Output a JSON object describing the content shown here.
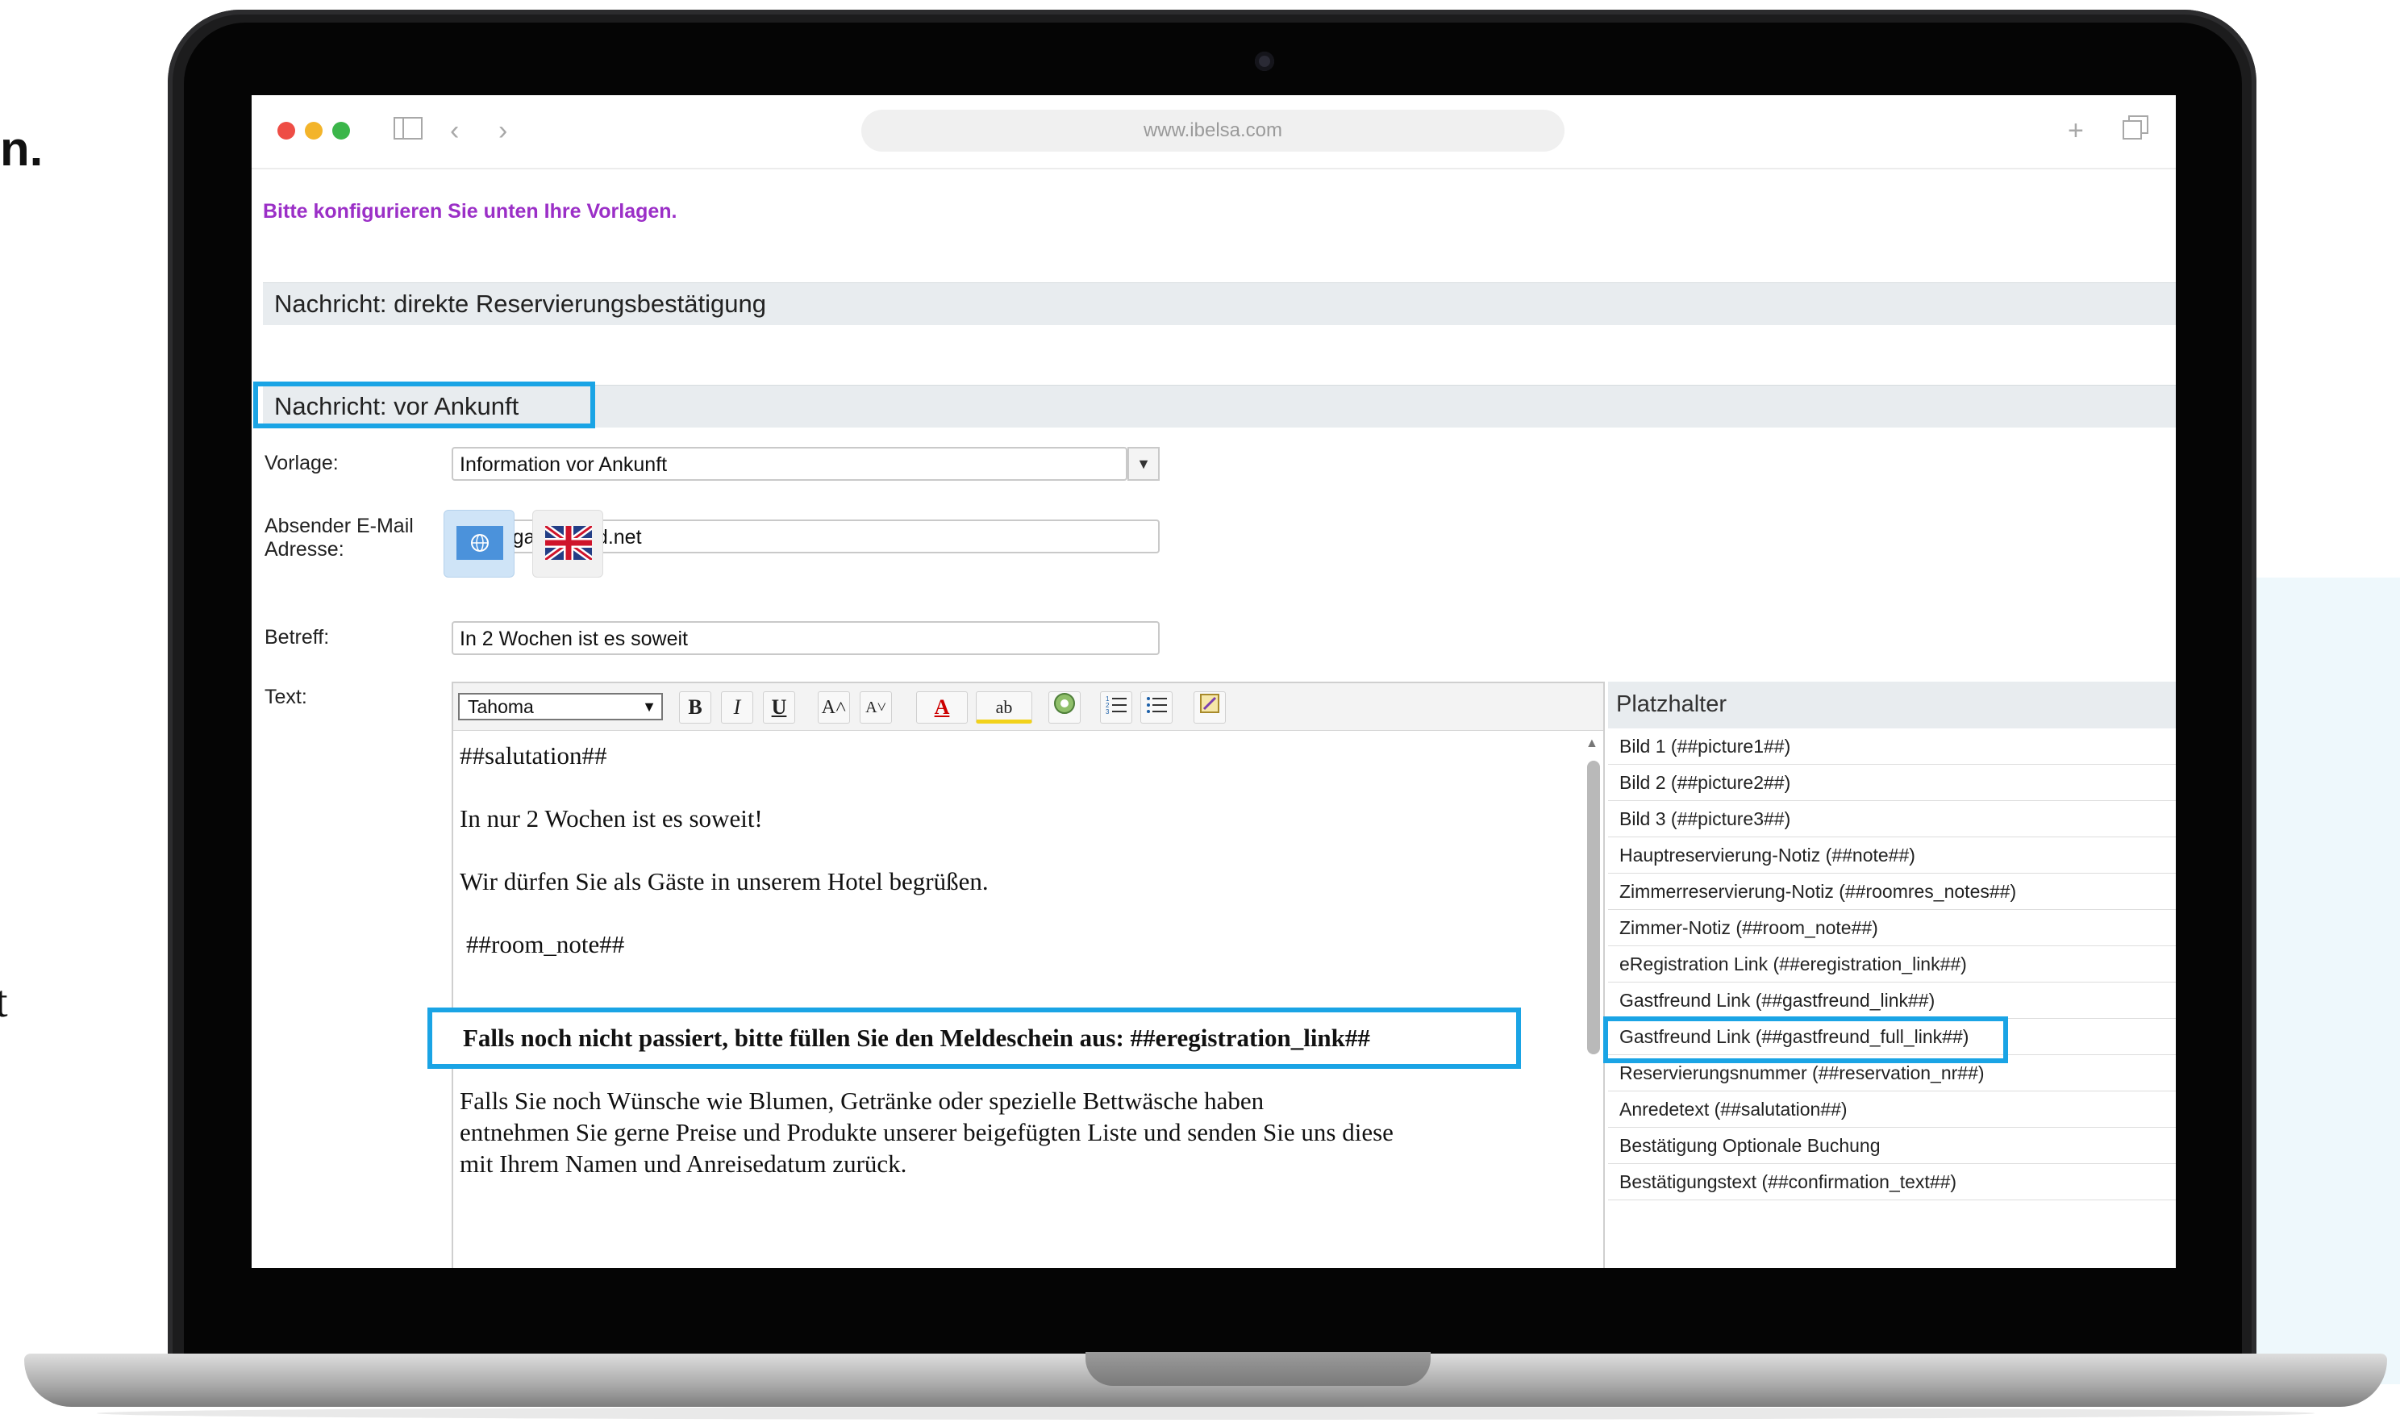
{
  "edge_text": {
    "left_fragment_1": "n.",
    "left_fragment_2": "t"
  },
  "browser": {
    "url": "www.ibelsa.com"
  },
  "page": {
    "intro": "Bitte konfigurieren Sie unten Ihre Vorlagen.",
    "section_direct": "Nachricht: direkte Reservierungsbestätigung",
    "section_before": "Nachricht: vor Ankunft",
    "form": {
      "template_label": "Vorlage:",
      "template_value": "Information vor Ankunft",
      "sender_label_1": "Absender E-Mail",
      "sender_label_2": "Adresse:",
      "sender_value": "info@gastfreund.net",
      "subject_label": "Betreff:",
      "subject_value": "In 2 Wochen ist es soweit",
      "text_label": "Text:"
    },
    "editor": {
      "font": "Tahoma",
      "toolbar": {
        "bold": "B",
        "italic": "I",
        "underline": "U",
        "grow": "A˄",
        "shrink": "A˅",
        "font_color": "A",
        "highlight": "ab"
      },
      "lines": [
        "##salutation##",
        "In nur 2 Wochen ist es soweit!",
        "Wir dürfen Sie als Gäste in unserem Hotel begrüßen.",
        "##room_note##",
        "Falls noch nicht passiert, bitte füllen Sie den Meldeschein aus: ##eregistration_link##",
        "Falls Sie noch Wünsche wie Blumen, Getränke oder spezielle Bettwäsche haben",
        "entnehmen Sie gerne Preise und Produkte unserer beigefügten Liste und senden Sie uns diese",
        "mit Ihrem Namen und Anreisedatum zurück."
      ]
    },
    "placeholders": {
      "title": "Platzhalter",
      "items": [
        "Bild 1 (##picture1##)",
        "Bild 2 (##picture2##)",
        "Bild 3 (##picture3##)",
        "Hauptreservierung-Notiz (##note##)",
        "Zimmerreservierung-Notiz (##roomres_notes##)",
        "Zimmer-Notiz (##room_note##)",
        "eRegistration Link (##eregistration_link##)",
        "Gastfreund Link (##gastfreund_link##)",
        "Gastfreund Link (##gastfreund_full_link##)",
        "Reservierungsnummer (##reservation_nr##)",
        "Anredetext (##salutation##)",
        "Bestätigung Optionale Buchung",
        "Bestätigungstext (##confirmation_text##)"
      ]
    }
  },
  "colors": {
    "highlight_border": "#1aa4e5",
    "intro_text": "#9b2fc7",
    "section_bg": "#e8ecef"
  }
}
